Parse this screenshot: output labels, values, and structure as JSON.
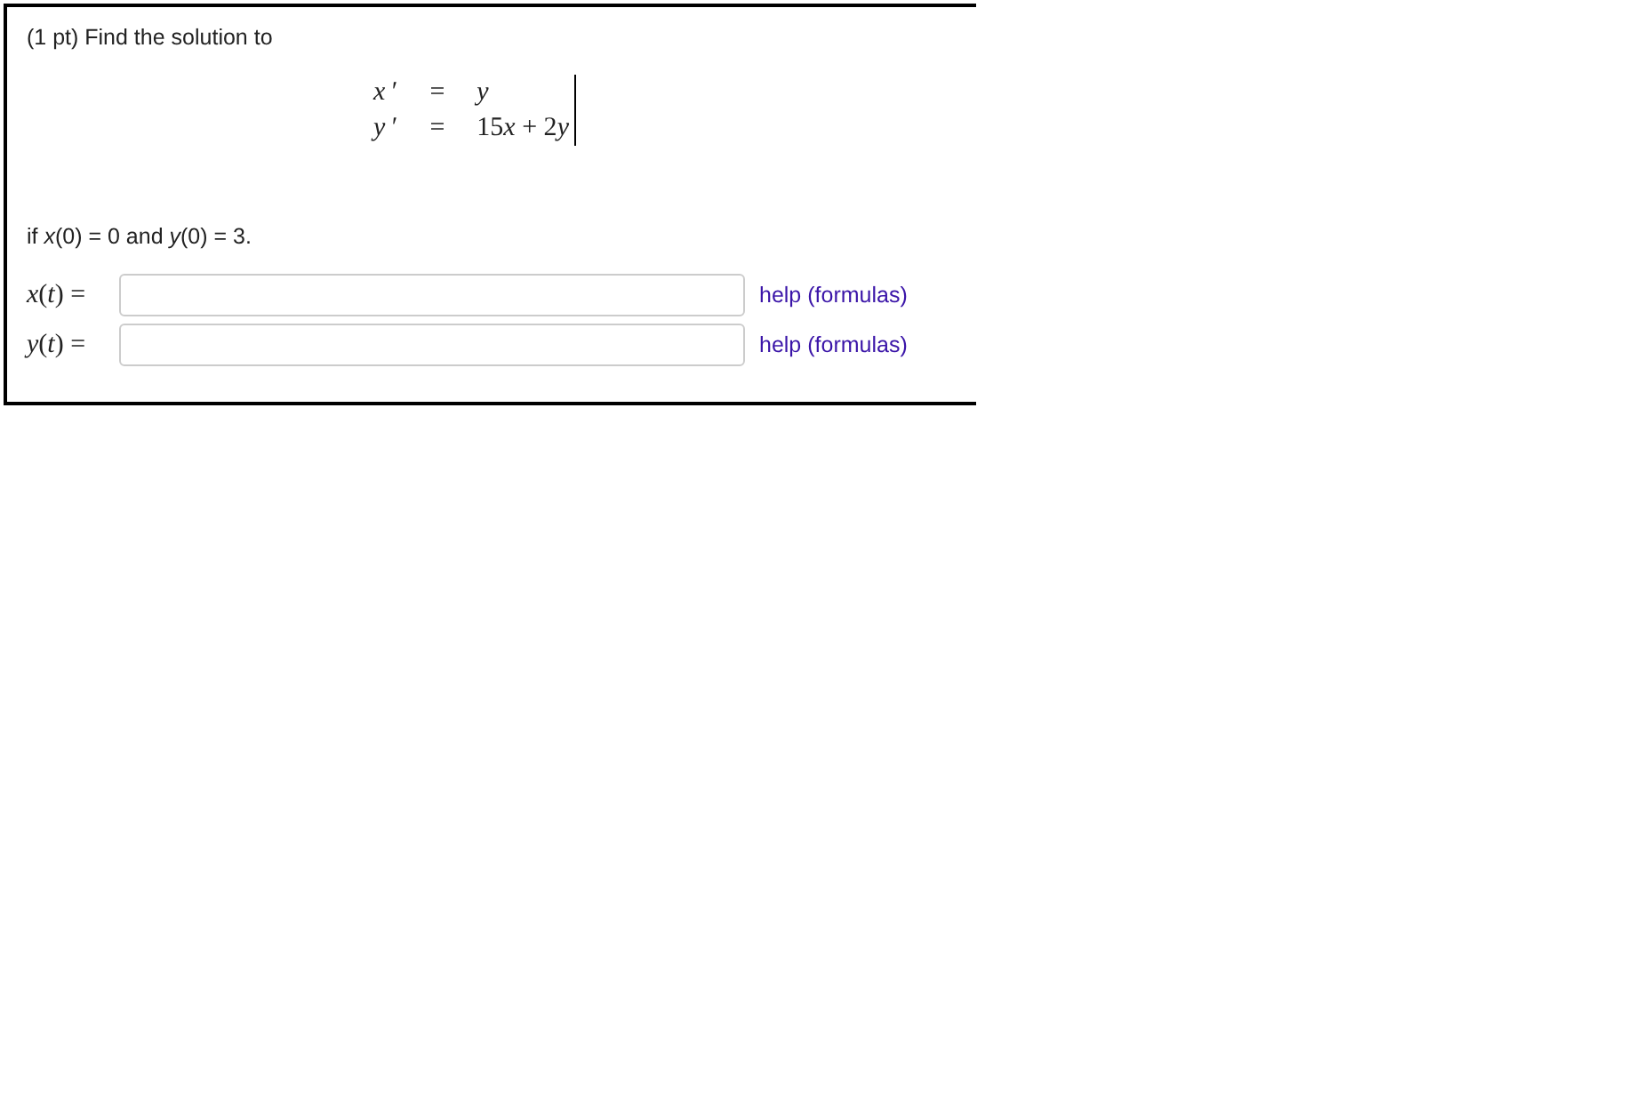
{
  "problem": {
    "prompt": "(1 pt) Find the solution to",
    "equations": [
      {
        "lhs": "*x* ′",
        "relation": "=",
        "rhs": "*y*"
      },
      {
        "lhs": "*y* ′",
        "relation": "=",
        "rhs_parts": [
          {
            "text": "15",
            "italic": false
          },
          {
            "text": "x",
            "italic": true
          },
          {
            "text": " + 2",
            "italic": false
          },
          {
            "text": "y",
            "italic": true
          }
        ]
      }
    ],
    "condition": "if *x*(0) = 0 and *y*(0) = 3.",
    "answers": [
      {
        "label": "*x*(*t*) =",
        "help": "help (formulas)"
      },
      {
        "label": "*y*(*t*) =",
        "help": "help (formulas)"
      }
    ]
  }
}
